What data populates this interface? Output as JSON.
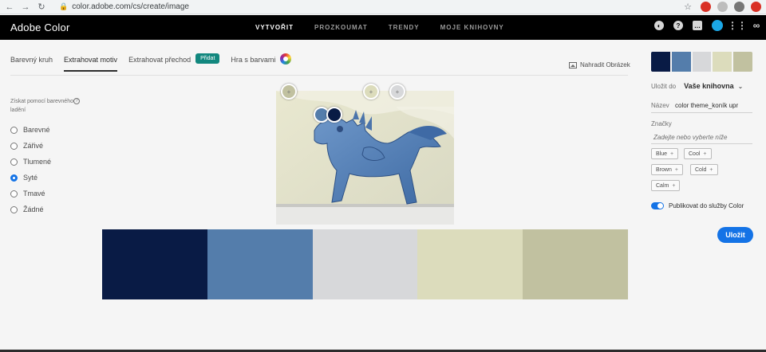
{
  "browser": {
    "url": "color.adobe.com/cs/create/image",
    "back": "←",
    "forward": "→",
    "reload": "↻",
    "lock": "🔒",
    "star": "☆"
  },
  "header": {
    "app_title": "Adobe Color",
    "nav": [
      "VYTVOŘIT",
      "PROZKOUMAT",
      "TRENDY",
      "MOJE KNIHOVNY"
    ],
    "active_nav": "VYTVOŘIT",
    "icons": [
      "moon-icon",
      "help-icon",
      "chat-icon",
      "avatar",
      "apps-grid-icon",
      "creative-cloud-icon"
    ]
  },
  "tabs": {
    "items": [
      "Barevný kruh",
      "Extrahovat motiv",
      "Extrahovat přechod"
    ],
    "add_label": "Přidat",
    "play": "Hra s barvami",
    "replace_image": "Nahradit Obrázek"
  },
  "mood": {
    "label": "Získat pomocí barevného ladění",
    "info": "?",
    "options": [
      "Barevné",
      "Zářivé",
      "Tlumené",
      "Syté",
      "Tmavé",
      "Žádné"
    ],
    "selected": "Syté"
  },
  "image": {
    "pickers": [
      "+",
      "+",
      "+"
    ]
  },
  "palette": {
    "colors": [
      "#091b45",
      "#547dab",
      "#d7d8da",
      "#dcdcbc",
      "#c1c1a0"
    ]
  },
  "panel": {
    "save_to_label": "Uložit do",
    "library": "Vaše knihovna",
    "chevron": "⌄",
    "name_label": "Název",
    "name_value": "color theme_koník upr",
    "tags_label": "Značky",
    "tags_placeholder": "Zadejte nebo vyberte níže",
    "tags": [
      "Blue",
      "Cool",
      "Brown",
      "Cold",
      "Calm"
    ],
    "tag_plus": "+",
    "publish_label": "Publikovat do služby Color",
    "save_button": "Uložit"
  }
}
